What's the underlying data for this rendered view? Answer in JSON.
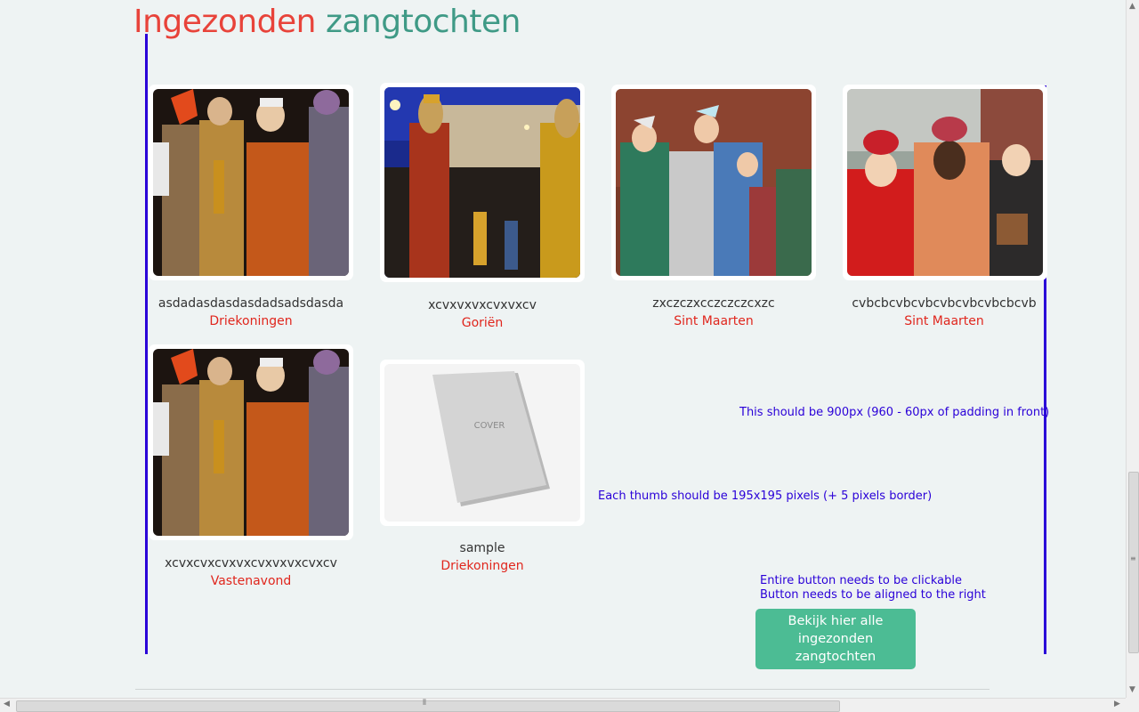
{
  "header": {
    "title_word1": "Ingezonden",
    "title_word2": "zangtochten"
  },
  "items": [
    {
      "name": "asdadasdasdasdadsadsdasda",
      "category": "Driekoningen",
      "image": "kings-with-saxophone-photo"
    },
    {
      "name": "xcvxvxvxcvxvxcv",
      "category": "Goriën",
      "image": "giant-figures-night-street-photo"
    },
    {
      "name": "zxczczxcczczczcxzc",
      "category": "Sint Maarten",
      "image": "children-with-crowns-photo"
    },
    {
      "name": "cvbcbcvbcvbcvbcvbcvbcbcvb",
      "category": "Sint Maarten",
      "image": "three-kings-children-photo"
    },
    {
      "name": "xcvxcvxcvxvxcvxvxvxcvxcv",
      "category": "Vastenavond",
      "image": "kings-with-saxophone-photo"
    },
    {
      "name": "sample",
      "category": "Driekoningen",
      "image": "cover-placeholder",
      "cover_text": "COVER"
    }
  ],
  "notes": {
    "width_note": "This should be 900px (960 - 60px of padding in front)",
    "thumb_note": "Each thumb should be 195x195 pixels (+ 5 pixels border)",
    "button_note_1": "Entire button needs to be clickable",
    "button_note_2": "Button needs to be aligned to the right"
  },
  "button": {
    "label": "Bekijk hier alle ingezonden zangtochten"
  },
  "colors": {
    "title_red": "#e8433a",
    "title_teal": "#3f9a86",
    "category_red": "#e0261d",
    "annotation_blue": "#2a00d8",
    "button_green": "#4cbc94",
    "background": "#eef3f3"
  }
}
